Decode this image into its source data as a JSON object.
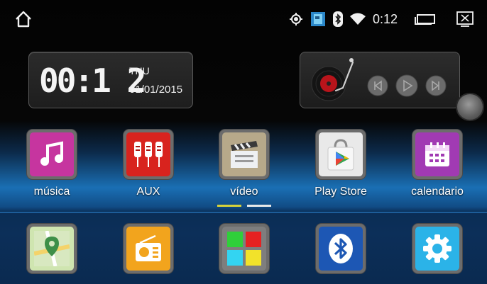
{
  "status": {
    "time": "0:12",
    "icons": [
      "home-icon",
      "location-icon",
      "app-notification-icon",
      "bluetooth-icon",
      "wifi-icon",
      "recent-apps-icon",
      "screen-icon"
    ]
  },
  "clock": {
    "time": "00:1 2",
    "day": "THU",
    "date": "01/01/2015"
  },
  "music": {
    "icons": [
      "vinyl-record-icon",
      "previous-icon",
      "play-icon",
      "next-icon"
    ]
  },
  "apps": [
    {
      "label": "música",
      "icon": "music-note-icon",
      "color": "#c6359f"
    },
    {
      "label": "AUX",
      "icon": "aux-cable-icon",
      "color": "#d8231e"
    },
    {
      "label": "vídeo",
      "icon": "clapperboard-icon",
      "color": "#b7a98a"
    },
    {
      "label": "Play Store",
      "icon": "play-store-icon",
      "color": "#e9e9e9"
    },
    {
      "label": "calendario",
      "icon": "calendar-icon",
      "color": "#a13ab3"
    }
  ],
  "dock": [
    {
      "icon": "maps-icon",
      "color": "#cfe5b0"
    },
    {
      "icon": "radio-icon",
      "color": "#f2a41d"
    },
    {
      "icon": "app-grid-icon",
      "color": "#7e7e7e"
    },
    {
      "icon": "bluetooth-icon",
      "color": "#1d57b4"
    },
    {
      "icon": "settings-gear-icon",
      "color": "#2bb3e8"
    }
  ],
  "colors": {
    "page_active": "#d7d23a",
    "page_inactive": "#e8e8e8",
    "accent_blue": "#1a6fb4"
  }
}
